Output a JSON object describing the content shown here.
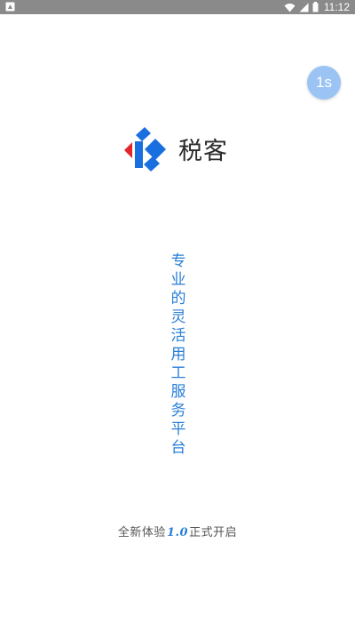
{
  "status_bar": {
    "time": "11:12",
    "icons": [
      "sim-icon",
      "wifi-icon",
      "signal-icon",
      "battery-icon"
    ]
  },
  "timer": {
    "label": "1s"
  },
  "brand": {
    "name": "税客",
    "colors": {
      "blue": "#1a6fe0",
      "red": "#e2262b"
    }
  },
  "slogan": {
    "text": "专业的灵活用工服务平台",
    "color": "#2a7fd8"
  },
  "footer": {
    "prefix": "全新体验",
    "version": "1.0",
    "suffix": "正式开启"
  }
}
